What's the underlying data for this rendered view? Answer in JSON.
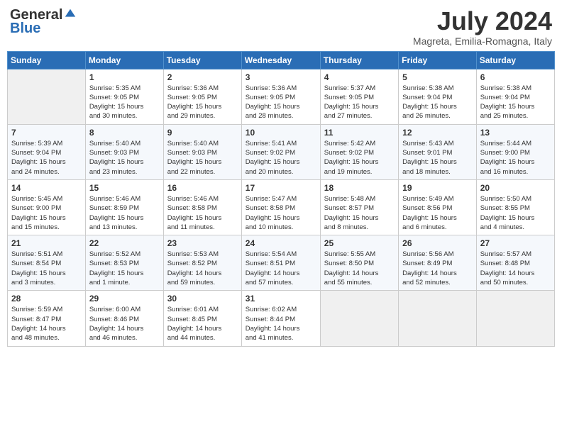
{
  "header": {
    "logo_general": "General",
    "logo_blue": "Blue",
    "month": "July 2024",
    "location": "Magreta, Emilia-Romagna, Italy"
  },
  "columns": [
    "Sunday",
    "Monday",
    "Tuesday",
    "Wednesday",
    "Thursday",
    "Friday",
    "Saturday"
  ],
  "weeks": [
    [
      {
        "day": "",
        "info": ""
      },
      {
        "day": "1",
        "info": "Sunrise: 5:35 AM\nSunset: 9:05 PM\nDaylight: 15 hours\nand 30 minutes."
      },
      {
        "day": "2",
        "info": "Sunrise: 5:36 AM\nSunset: 9:05 PM\nDaylight: 15 hours\nand 29 minutes."
      },
      {
        "day": "3",
        "info": "Sunrise: 5:36 AM\nSunset: 9:05 PM\nDaylight: 15 hours\nand 28 minutes."
      },
      {
        "day": "4",
        "info": "Sunrise: 5:37 AM\nSunset: 9:05 PM\nDaylight: 15 hours\nand 27 minutes."
      },
      {
        "day": "5",
        "info": "Sunrise: 5:38 AM\nSunset: 9:04 PM\nDaylight: 15 hours\nand 26 minutes."
      },
      {
        "day": "6",
        "info": "Sunrise: 5:38 AM\nSunset: 9:04 PM\nDaylight: 15 hours\nand 25 minutes."
      }
    ],
    [
      {
        "day": "7",
        "info": "Sunrise: 5:39 AM\nSunset: 9:04 PM\nDaylight: 15 hours\nand 24 minutes."
      },
      {
        "day": "8",
        "info": "Sunrise: 5:40 AM\nSunset: 9:03 PM\nDaylight: 15 hours\nand 23 minutes."
      },
      {
        "day": "9",
        "info": "Sunrise: 5:40 AM\nSunset: 9:03 PM\nDaylight: 15 hours\nand 22 minutes."
      },
      {
        "day": "10",
        "info": "Sunrise: 5:41 AM\nSunset: 9:02 PM\nDaylight: 15 hours\nand 20 minutes."
      },
      {
        "day": "11",
        "info": "Sunrise: 5:42 AM\nSunset: 9:02 PM\nDaylight: 15 hours\nand 19 minutes."
      },
      {
        "day": "12",
        "info": "Sunrise: 5:43 AM\nSunset: 9:01 PM\nDaylight: 15 hours\nand 18 minutes."
      },
      {
        "day": "13",
        "info": "Sunrise: 5:44 AM\nSunset: 9:00 PM\nDaylight: 15 hours\nand 16 minutes."
      }
    ],
    [
      {
        "day": "14",
        "info": "Sunrise: 5:45 AM\nSunset: 9:00 PM\nDaylight: 15 hours\nand 15 minutes."
      },
      {
        "day": "15",
        "info": "Sunrise: 5:46 AM\nSunset: 8:59 PM\nDaylight: 15 hours\nand 13 minutes."
      },
      {
        "day": "16",
        "info": "Sunrise: 5:46 AM\nSunset: 8:58 PM\nDaylight: 15 hours\nand 11 minutes."
      },
      {
        "day": "17",
        "info": "Sunrise: 5:47 AM\nSunset: 8:58 PM\nDaylight: 15 hours\nand 10 minutes."
      },
      {
        "day": "18",
        "info": "Sunrise: 5:48 AM\nSunset: 8:57 PM\nDaylight: 15 hours\nand 8 minutes."
      },
      {
        "day": "19",
        "info": "Sunrise: 5:49 AM\nSunset: 8:56 PM\nDaylight: 15 hours\nand 6 minutes."
      },
      {
        "day": "20",
        "info": "Sunrise: 5:50 AM\nSunset: 8:55 PM\nDaylight: 15 hours\nand 4 minutes."
      }
    ],
    [
      {
        "day": "21",
        "info": "Sunrise: 5:51 AM\nSunset: 8:54 PM\nDaylight: 15 hours\nand 3 minutes."
      },
      {
        "day": "22",
        "info": "Sunrise: 5:52 AM\nSunset: 8:53 PM\nDaylight: 15 hours\nand 1 minute."
      },
      {
        "day": "23",
        "info": "Sunrise: 5:53 AM\nSunset: 8:52 PM\nDaylight: 14 hours\nand 59 minutes."
      },
      {
        "day": "24",
        "info": "Sunrise: 5:54 AM\nSunset: 8:51 PM\nDaylight: 14 hours\nand 57 minutes."
      },
      {
        "day": "25",
        "info": "Sunrise: 5:55 AM\nSunset: 8:50 PM\nDaylight: 14 hours\nand 55 minutes."
      },
      {
        "day": "26",
        "info": "Sunrise: 5:56 AM\nSunset: 8:49 PM\nDaylight: 14 hours\nand 52 minutes."
      },
      {
        "day": "27",
        "info": "Sunrise: 5:57 AM\nSunset: 8:48 PM\nDaylight: 14 hours\nand 50 minutes."
      }
    ],
    [
      {
        "day": "28",
        "info": "Sunrise: 5:59 AM\nSunset: 8:47 PM\nDaylight: 14 hours\nand 48 minutes."
      },
      {
        "day": "29",
        "info": "Sunrise: 6:00 AM\nSunset: 8:46 PM\nDaylight: 14 hours\nand 46 minutes."
      },
      {
        "day": "30",
        "info": "Sunrise: 6:01 AM\nSunset: 8:45 PM\nDaylight: 14 hours\nand 44 minutes."
      },
      {
        "day": "31",
        "info": "Sunrise: 6:02 AM\nSunset: 8:44 PM\nDaylight: 14 hours\nand 41 minutes."
      },
      {
        "day": "",
        "info": ""
      },
      {
        "day": "",
        "info": ""
      },
      {
        "day": "",
        "info": ""
      }
    ]
  ]
}
